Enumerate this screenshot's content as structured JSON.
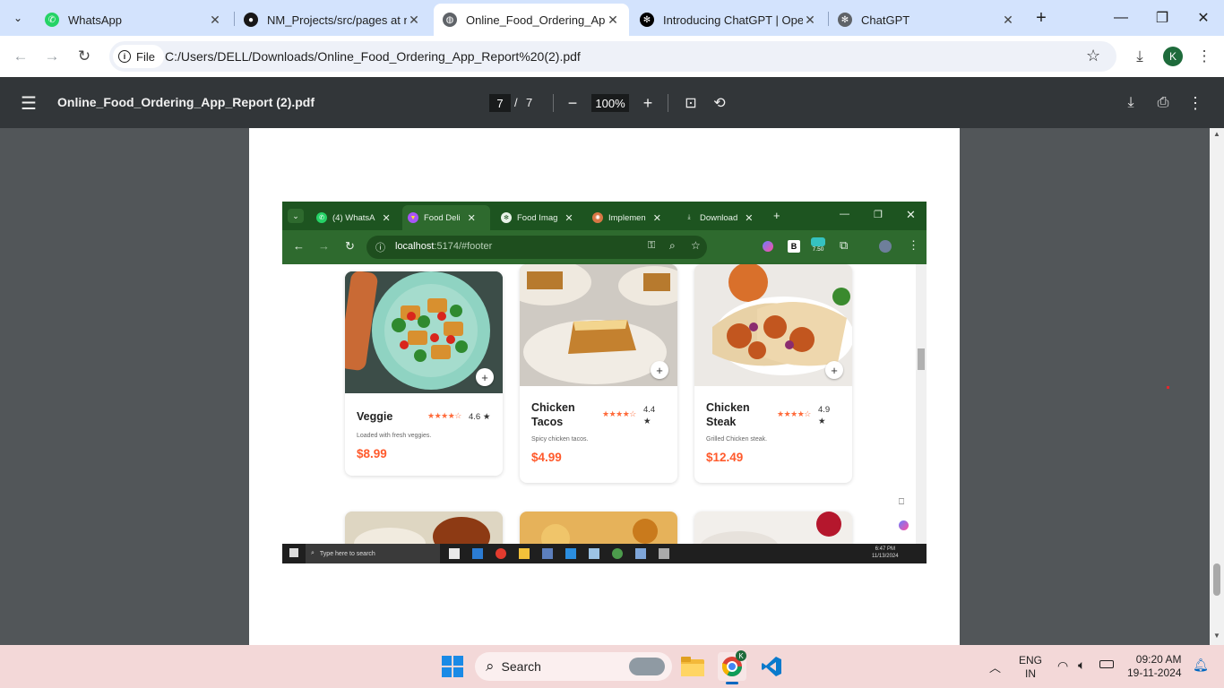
{
  "browser": {
    "tabs": [
      {
        "label": "WhatsApp",
        "icon": "whatsapp-icon",
        "color": "#25d366"
      },
      {
        "label": "NM_Projects/src/pages at m",
        "icon": "github-icon",
        "color": "#181717"
      },
      {
        "label": "Online_Food_Ordering_App_",
        "icon": "globe-icon",
        "color": "#5f6368"
      },
      {
        "label": "Introducing ChatGPT | Open",
        "icon": "openai-icon",
        "color": "#000000"
      },
      {
        "label": "ChatGPT",
        "icon": "openai-icon",
        "color": "#000000"
      }
    ],
    "active_tab": 2,
    "close_glyph": "✕",
    "new_tab_glyph": "+",
    "file_chip": "File",
    "url": "C:/Users/DELL/Downloads/Online_Food_Ordering_App_Report%20(2).pdf",
    "avatar_letter": "K"
  },
  "pdf": {
    "title": "Online_Food_Ordering_App_Report (2).pdf",
    "current_page": "7",
    "page_sep": "/",
    "total_pages": "7",
    "zoom": "100%"
  },
  "screenshot": {
    "tabs": [
      {
        "label": "(4) WhatsA",
        "color": "#25d366"
      },
      {
        "label": "Food Deli",
        "color": "#a855f7"
      },
      {
        "label": "Food Imag",
        "color": "#ffffff"
      },
      {
        "label": "Implemen",
        "color": "#d97745"
      },
      {
        "label": "Download",
        "color": "#ffffff"
      }
    ],
    "active_tab": 1,
    "url_host": "localhost",
    "url_rest": ":5174/#footer",
    "ext_badge": "7.50",
    "cards": [
      {
        "name": "Veggie",
        "stars": "★★★★☆",
        "rating": "4.6 ★",
        "desc": "Loaded with fresh veggies.",
        "price": "$8.99"
      },
      {
        "name": "Chicken Tacos",
        "stars": "★★★★☆",
        "rating": "4.4 ★",
        "desc": "Spicy chicken tacos.",
        "price": "$4.99"
      },
      {
        "name": "Chicken Steak",
        "stars": "★★★★☆",
        "rating": "4.9 ★",
        "desc": "Grilled Chicken steak.",
        "price": "$12.49"
      }
    ],
    "taskbar_search": "Type here to search",
    "taskbar_time": "6:47 PM",
    "taskbar_date": "11/13/2024"
  },
  "taskbar": {
    "search_placeholder": "Search",
    "language": "ENG",
    "region": "IN",
    "time": "09:20 AM",
    "date": "19-11-2024"
  }
}
